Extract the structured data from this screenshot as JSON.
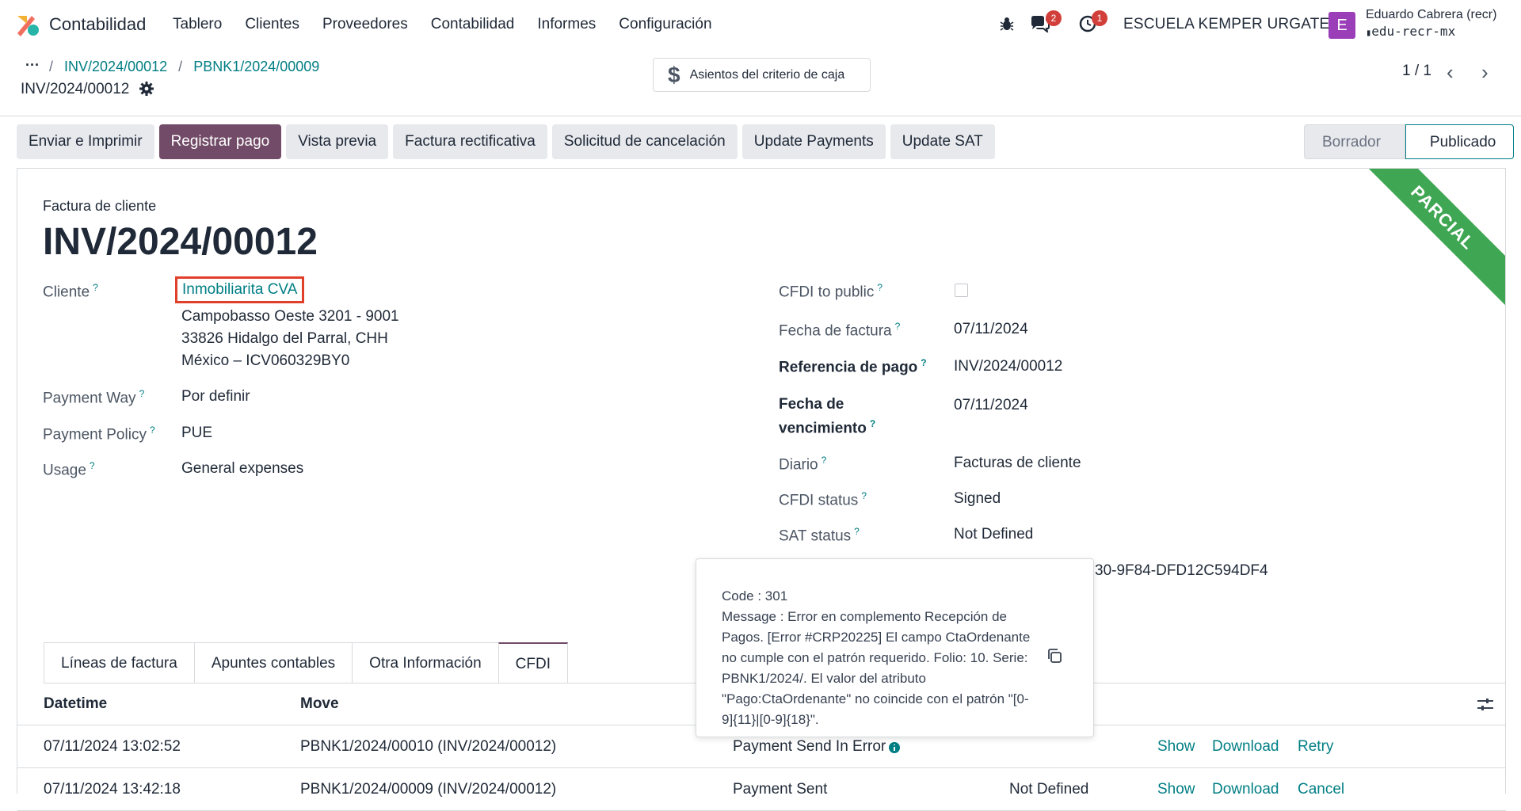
{
  "nav": {
    "app_name": "Contabilidad",
    "menu": [
      "Tablero",
      "Clientes",
      "Proveedores",
      "Contabilidad",
      "Informes",
      "Configuración"
    ],
    "messages_count": "2",
    "activities_count": "1",
    "company": "ESCUELA KEMPER URGATE",
    "avatar_letter": "E",
    "user_name": "Eduardo Cabrera (recr)",
    "user_db": "edu-recr-mx"
  },
  "control": {
    "breadcrumb": [
      "INV/2024/00012",
      "PBNK1/2024/00009"
    ],
    "record_title": "INV/2024/00012",
    "cash_basis_button": "Asientos del criterio de caja",
    "pager": "1 / 1"
  },
  "actions": {
    "buttons": [
      "Enviar e Imprimir",
      "Registrar pago",
      "Vista previa",
      "Factura rectificativa",
      "Solicitud de cancelación",
      "Update Payments",
      "Update SAT"
    ],
    "status": [
      "Borrador",
      "Publicado"
    ]
  },
  "form": {
    "ribbon": "PARCIAL",
    "type": "Factura de cliente",
    "name": "INV/2024/00012",
    "left": {
      "cliente_label": "Cliente",
      "cliente": "Inmobiliarita CVA",
      "address": [
        "Campobasso Oeste 3201 - 9001",
        "33826 Hidalgo del Parral, CHH",
        "México – ICV060329BY0"
      ],
      "payment_way_label": "Payment Way",
      "payment_way": "Por definir",
      "payment_policy_label": "Payment Policy",
      "payment_policy": "PUE",
      "usage_label": "Usage",
      "usage": "General expenses"
    },
    "right": {
      "cfdi_public_label": "CFDI to public",
      "fecha_factura_label": "Fecha de factura",
      "fecha_factura": "07/11/2024",
      "ref_pago_label": "Referencia de pago",
      "ref_pago": "INV/2024/00012",
      "vencimiento_label_1": "Fecha de",
      "vencimiento_label_2": "vencimiento",
      "vencimiento": "07/11/2024",
      "diario_label": "Diario",
      "diario": "Facturas de cliente",
      "cfdi_status_label": "CFDI status",
      "cfdi_status": "Signed",
      "sat_status_label": "SAT status",
      "sat_status": "Not Defined",
      "uuid_partial": "30-9F84-DFD12C594DF4"
    }
  },
  "tabs": [
    "Líneas de factura",
    "Apuntes contables",
    "Otra Información",
    "CFDI"
  ],
  "table": {
    "headers": [
      "Datetime",
      "Move"
    ],
    "rows": [
      {
        "datetime": "07/11/2024 13:02:52",
        "move": "PBNK1/2024/00010 (INV/2024/00012)",
        "state": "Payment Send In Error",
        "sat": "",
        "actions": [
          "Show",
          "Download",
          "Retry"
        ]
      },
      {
        "datetime": "07/11/2024 13:42:18",
        "move": "PBNK1/2024/00009 (INV/2024/00012)",
        "state": "Payment Sent",
        "sat": "Not Defined",
        "actions": [
          "Show",
          "Download",
          "Cancel"
        ]
      }
    ]
  },
  "popover": {
    "lines": [
      "Code : 301",
      "Message : Error en complemento Recepción de Pagos. [Error #CRP20225] El campo CtaOrdenante no cumple con el patrón requerido. Folio: 10. Serie: PBNK1/2024/. El valor del atributo \"Pago:CtaOrdenante\" no coincide con el patrón \"[0-9]{11}|[0-9]{18}\"."
    ]
  },
  "colors": {
    "accent": "#017e84",
    "primary": "#714b67",
    "ribbon": "#3fa653",
    "badge": "#d23f3a"
  }
}
